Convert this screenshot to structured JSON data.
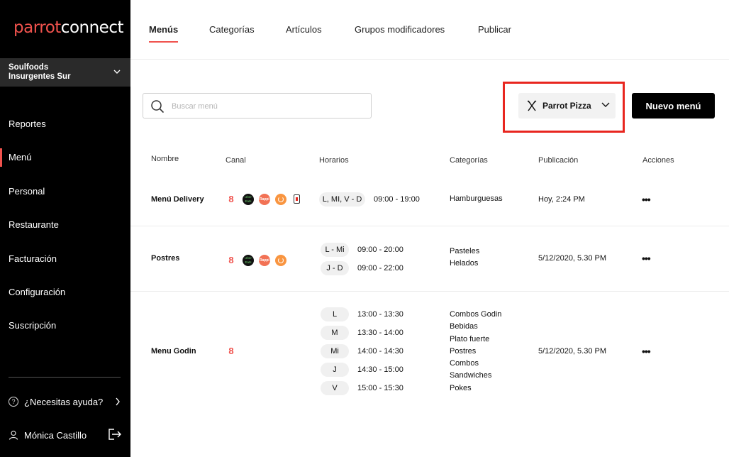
{
  "sidebar": {
    "logo_part1": "parrot",
    "logo_part2": "connect",
    "store_name": "Soulfoods\nInsurgentes Sur",
    "nav": [
      {
        "label": "Reportes"
      },
      {
        "label": "Menú"
      },
      {
        "label": "Personal"
      },
      {
        "label": "Restaurante"
      },
      {
        "label": "Facturación"
      },
      {
        "label": "Configuración"
      },
      {
        "label": "Suscripción"
      }
    ],
    "help_label": "¿Necesitas ayuda?",
    "user_name": "Mónica Castillo"
  },
  "tabs": [
    {
      "label": "Menús"
    },
    {
      "label": "Categorías"
    },
    {
      "label": "Artículos"
    },
    {
      "label": "Grupos modificadores"
    },
    {
      "label": "Publicar"
    }
  ],
  "toolbar": {
    "search_placeholder": "Buscar menú",
    "brand_label": "Parrot Pizza",
    "new_menu_label": "Nuevo menú"
  },
  "table": {
    "headers": {
      "name": "Nombre",
      "channel": "Canal",
      "hours": "Horarios",
      "categories": "Categorías",
      "publication": "Publicación",
      "actions": "Acciones"
    },
    "rows": [
      {
        "name": "Menú Delivery",
        "channels": [
          "parrot",
          "uber-eats",
          "rappi",
          "didi-food",
          "phone"
        ],
        "schedules": [
          {
            "days": "L, MI, V - D",
            "time": "09:00 - 19:00"
          }
        ],
        "categories": [
          "Hamburguesas"
        ],
        "publication": "Hoy, 2:24 PM",
        "actions": "•••"
      },
      {
        "name": "Postres",
        "channels": [
          "parrot",
          "uber-eats",
          "rappi",
          "didi-food"
        ],
        "schedules": [
          {
            "days": "L - Mi",
            "time": "09:00 - 20:00"
          },
          {
            "days": "J - D",
            "time": "09:00 - 22:00"
          }
        ],
        "categories": [
          "Pasteles",
          "Helados"
        ],
        "publication": "5/12/2020, 5.30 PM",
        "actions": "•••"
      },
      {
        "name": "Menu Godin",
        "channels": [
          "parrot"
        ],
        "schedules": [
          {
            "days": "L",
            "time": "13:00 - 13:30"
          },
          {
            "days": "M",
            "time": "13:30 - 14:00"
          },
          {
            "days": "Mi",
            "time": "14:00 - 14:30"
          },
          {
            "days": "J",
            "time": "14:30 - 15:00"
          },
          {
            "days": "V",
            "time": "15:00 - 15:30"
          }
        ],
        "categories": [
          "Combos Godin",
          "Bebidas",
          "Plato fuerte",
          "Postres",
          "Combos",
          "Sandwiches",
          "Pokes"
        ],
        "publication": "5/12/2020, 5.30 PM",
        "actions": "•••"
      }
    ]
  },
  "colors": {
    "accent": "#f0524d",
    "highlight": "#e8261f",
    "sidebar_bg": "#000000"
  }
}
